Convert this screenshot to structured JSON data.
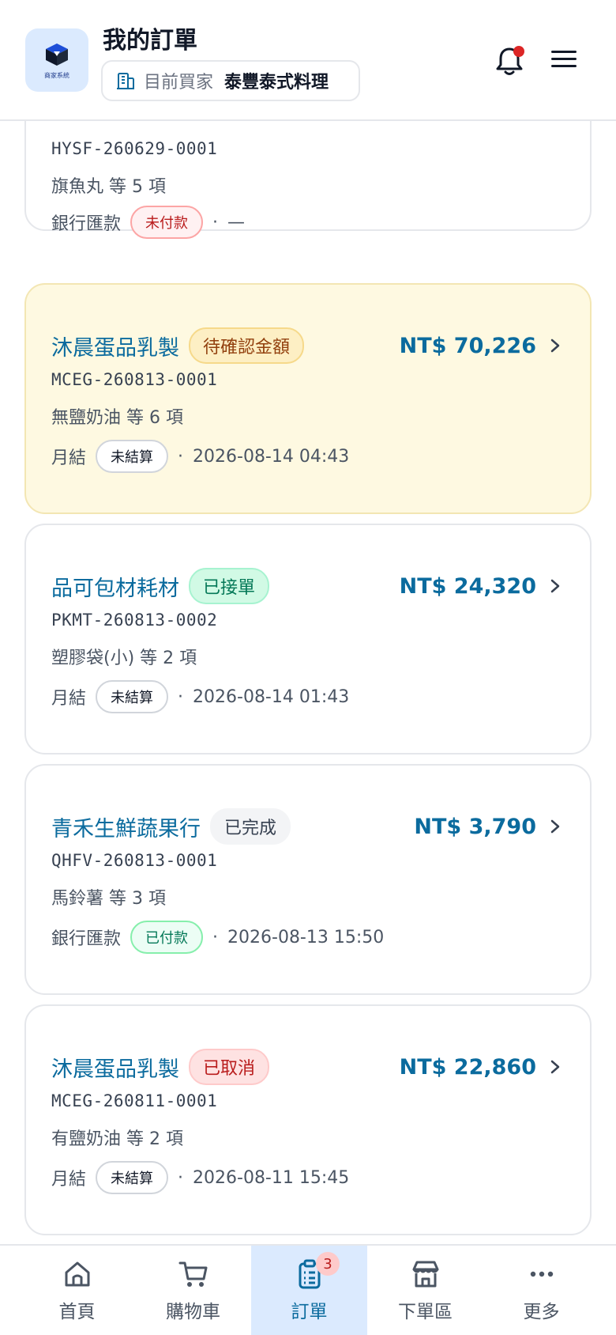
{
  "header": {
    "logo_text": "商家系統",
    "title": "我的訂單",
    "buyer_label": "目前買家",
    "buyer_name": "泰豐泰式料理"
  },
  "orders": [
    {
      "supplier": "",
      "status": "",
      "amount": "",
      "order_no": "HYSF-260629-0001",
      "items": "旗魚丸 等 5 項",
      "payment_method": "銀行匯款",
      "payment_status": "未付款",
      "payment_time": "—"
    },
    {
      "supplier": "沐晨蛋品乳製",
      "status": "待確認金額",
      "amount": "NT$ 70,226",
      "order_no": "MCEG-260813-0001",
      "items": "無鹽奶油 等 6 項",
      "payment_method": "月結",
      "payment_status": "未結算",
      "payment_time": "2026-08-14 04:43"
    },
    {
      "supplier": "品可包材耗材",
      "status": "已接單",
      "amount": "NT$ 24,320",
      "order_no": "PKMT-260813-0002",
      "items": "塑膠袋(小) 等 2 項",
      "payment_method": "月結",
      "payment_status": "未結算",
      "payment_time": "2026-08-14 01:43"
    },
    {
      "supplier": "青禾生鮮蔬果行",
      "status": "已完成",
      "amount": "NT$ 3,790",
      "order_no": "QHFV-260813-0001",
      "items": "馬鈴薯 等 3 項",
      "payment_method": "銀行匯款",
      "payment_status": "已付款",
      "payment_time": "2026-08-13 15:50"
    },
    {
      "supplier": "沐晨蛋品乳製",
      "status": "已取消",
      "amount": "NT$ 22,860",
      "order_no": "MCEG-260811-0001",
      "items": "有鹽奶油 等 2 項",
      "payment_method": "月結",
      "payment_status": "未結算",
      "payment_time": "2026-08-11 15:45"
    }
  ],
  "separator": "·",
  "bottom_nav": {
    "items": [
      {
        "label": "首頁",
        "icon": "home-icon"
      },
      {
        "label": "購物車",
        "icon": "cart-icon"
      },
      {
        "label": "訂單",
        "icon": "clipboard-list-icon",
        "badge": "3",
        "active": true
      },
      {
        "label": "下單區",
        "icon": "store-icon"
      },
      {
        "label": "更多",
        "icon": "more-dots-icon"
      }
    ]
  },
  "colors": {
    "accent": "#0b6b9e",
    "active_nav_bg": "#dbeafe",
    "highlight_card_bg": "#fef9e1",
    "notification_dot": "#dc2626"
  }
}
